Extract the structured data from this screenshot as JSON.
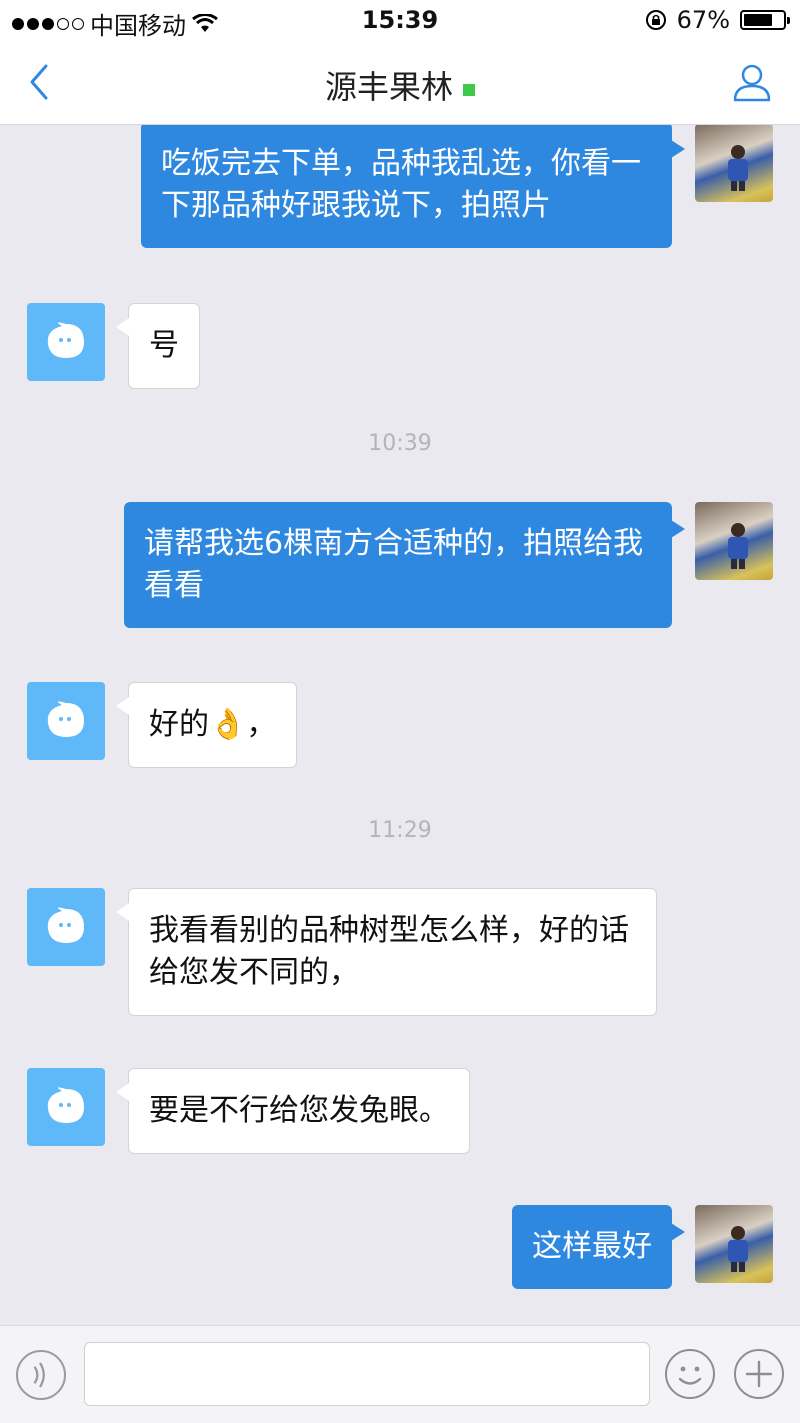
{
  "status_bar": {
    "carrier": "中国移动",
    "time": "15:39",
    "battery": "67%",
    "battery_level": 0.67
  },
  "nav": {
    "title": "源丰果林",
    "online_color": "#3ec94a",
    "back_icon": "chevron-left-icon",
    "profile_icon": "person-icon"
  },
  "colors": {
    "accent": "#2f88e0",
    "bot_avatar": "#5fb8f7"
  },
  "messages": [
    {
      "from": "me",
      "text": "吃饭完去下单，品种我乱选，你看一下那品种好跟我说下，拍照片"
    },
    {
      "from": "shop",
      "text": "号"
    },
    {
      "timestamp": "10:39"
    },
    {
      "from": "me",
      "text": "请帮我选6棵南方合适种的，拍照给我看看"
    },
    {
      "from": "shop",
      "text": "好的👌，"
    },
    {
      "timestamp": "11:29"
    },
    {
      "from": "shop",
      "text": "我看看别的品种树型怎么样，好的话给您发不同的，"
    },
    {
      "from": "shop",
      "text": "要是不行给您发兔眼。"
    },
    {
      "from": "me",
      "text": "这样最好"
    }
  ],
  "input_bar": {
    "voice_icon": "voice-icon",
    "emoji_icon": "emoji-icon",
    "plus_icon": "plus-icon"
  }
}
